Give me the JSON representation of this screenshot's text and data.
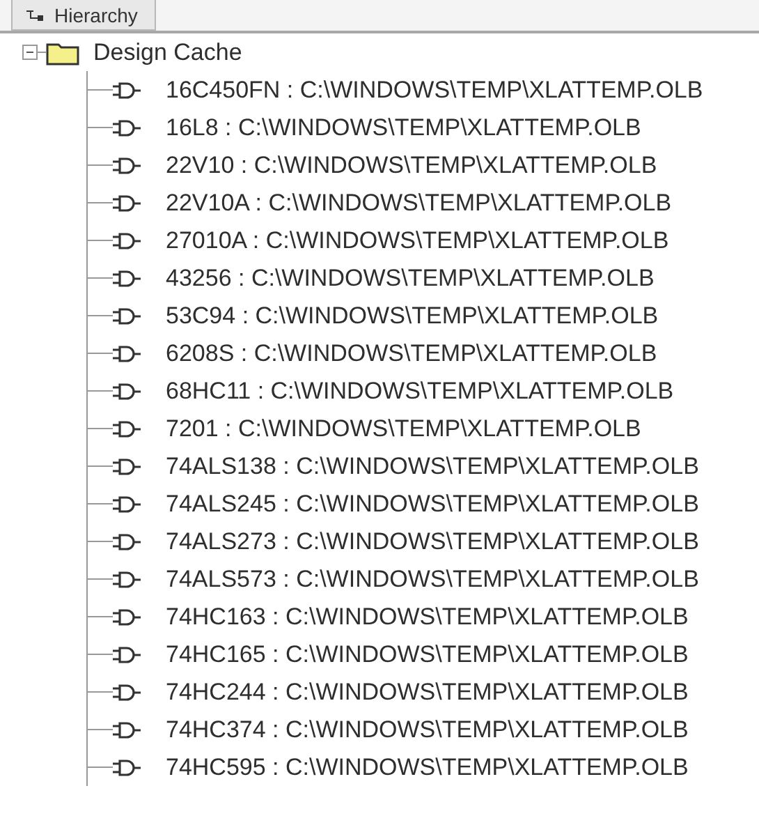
{
  "tab": {
    "label": "Hierarchy"
  },
  "tree": {
    "label": "Design Cache",
    "expanded": true,
    "children": [
      {
        "label": "16C450FN : C:\\WINDOWS\\TEMP\\XLATTEMP.OLB"
      },
      {
        "label": "16L8 : C:\\WINDOWS\\TEMP\\XLATTEMP.OLB"
      },
      {
        "label": "22V10 : C:\\WINDOWS\\TEMP\\XLATTEMP.OLB"
      },
      {
        "label": "22V10A : C:\\WINDOWS\\TEMP\\XLATTEMP.OLB"
      },
      {
        "label": "27010A : C:\\WINDOWS\\TEMP\\XLATTEMP.OLB"
      },
      {
        "label": "43256 : C:\\WINDOWS\\TEMP\\XLATTEMP.OLB"
      },
      {
        "label": "53C94 : C:\\WINDOWS\\TEMP\\XLATTEMP.OLB"
      },
      {
        "label": "6208S : C:\\WINDOWS\\TEMP\\XLATTEMP.OLB"
      },
      {
        "label": "68HC11 : C:\\WINDOWS\\TEMP\\XLATTEMP.OLB"
      },
      {
        "label": "7201 : C:\\WINDOWS\\TEMP\\XLATTEMP.OLB"
      },
      {
        "label": "74ALS138 : C:\\WINDOWS\\TEMP\\XLATTEMP.OLB"
      },
      {
        "label": "74ALS245 : C:\\WINDOWS\\TEMP\\XLATTEMP.OLB"
      },
      {
        "label": "74ALS273 : C:\\WINDOWS\\TEMP\\XLATTEMP.OLB"
      },
      {
        "label": "74ALS573 : C:\\WINDOWS\\TEMP\\XLATTEMP.OLB"
      },
      {
        "label": "74HC163 : C:\\WINDOWS\\TEMP\\XLATTEMP.OLB"
      },
      {
        "label": "74HC165 : C:\\WINDOWS\\TEMP\\XLATTEMP.OLB"
      },
      {
        "label": "74HC244 : C:\\WINDOWS\\TEMP\\XLATTEMP.OLB"
      },
      {
        "label": "74HC374 : C:\\WINDOWS\\TEMP\\XLATTEMP.OLB"
      },
      {
        "label": "74HC595 : C:\\WINDOWS\\TEMP\\XLATTEMP.OLB"
      }
    ]
  }
}
